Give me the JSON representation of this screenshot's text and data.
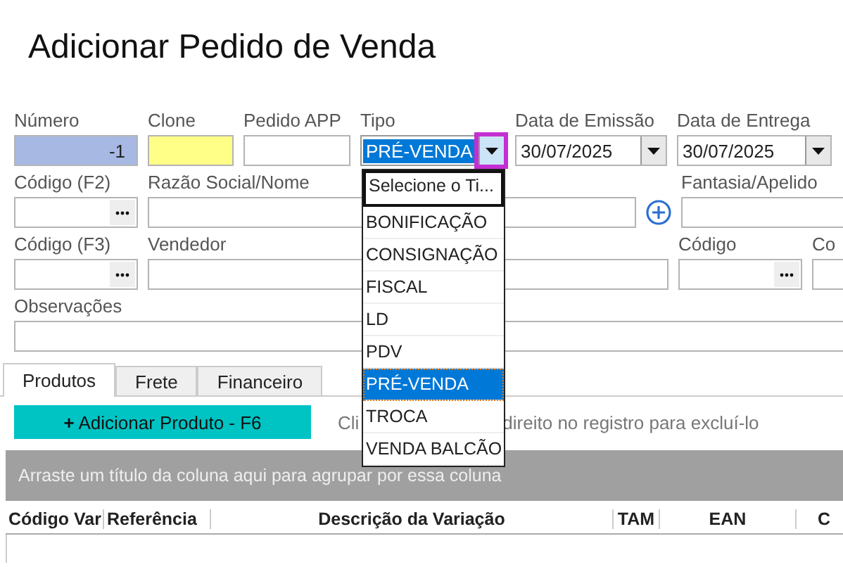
{
  "title": "Adicionar Pedido de Venda",
  "rows": [
    [
      {
        "label": "Número",
        "kind": "readonly",
        "value": "-1"
      },
      {
        "label": "Clone",
        "kind": "highlight"
      },
      {
        "label": "Pedido APP",
        "kind": "text"
      },
      {
        "label": "Tipo",
        "kind": "select",
        "value": "PRÉ-VENDA",
        "expanded": true
      },
      {
        "label": "Data de Emissão",
        "kind": "date",
        "value": "30/07/2025"
      },
      {
        "label": "Data de Entrega",
        "kind": "date",
        "value": "30/07/2025"
      }
    ],
    [
      {
        "label": "Código (F2)",
        "kind": "lookup"
      },
      {
        "label": "Razão Social/Nome",
        "kind": "text"
      },
      {
        "kind": "add"
      },
      {
        "label": "Fantasia/Apelido",
        "kind": "text"
      }
    ],
    [
      {
        "label": "Código (F3)",
        "kind": "lookup"
      },
      {
        "label": "Vendedor",
        "kind": "text"
      },
      {
        "label": "Código",
        "kind": "lookup"
      },
      {
        "label": "Co",
        "kind": "text"
      }
    ],
    [
      {
        "label": "Observações",
        "kind": "text"
      }
    ]
  ],
  "dropdown": [
    {
      "label": "Selecione o Ti...",
      "kind": "prompt",
      "selected": false
    },
    {
      "label": "BONIFICAÇÃO",
      "kind": "option",
      "selected": false
    },
    {
      "label": "CONSIGNAÇÃO",
      "kind": "option",
      "selected": false
    },
    {
      "label": "FISCAL",
      "kind": "option",
      "selected": false
    },
    {
      "label": "LD",
      "kind": "option",
      "selected": false
    },
    {
      "label": "PDV",
      "kind": "option",
      "selected": false
    },
    {
      "label": "PRÉ-VENDA",
      "kind": "option",
      "selected": true
    },
    {
      "label": "TROCA",
      "kind": "option",
      "selected": false
    },
    {
      "label": "VENDA BALCÃO",
      "kind": "option",
      "selected": false
    }
  ],
  "tabs": [
    {
      "label": "Produtos",
      "selected": true
    },
    {
      "label": "Frete",
      "selected": false
    },
    {
      "label": "Financeiro",
      "selected": false
    }
  ],
  "add_button": {
    "icon": "+",
    "label": "Adicionar Produto - F6"
  },
  "hint": [
    "Cli",
    "direito no registro para excluí-lo"
  ],
  "group_panel": "Arraste um título da coluna aqui para agrupar por essa coluna",
  "columns": [
    "Código Var",
    "Referência",
    "Descrição da Variação",
    "TAM",
    "EAN",
    "C"
  ]
}
